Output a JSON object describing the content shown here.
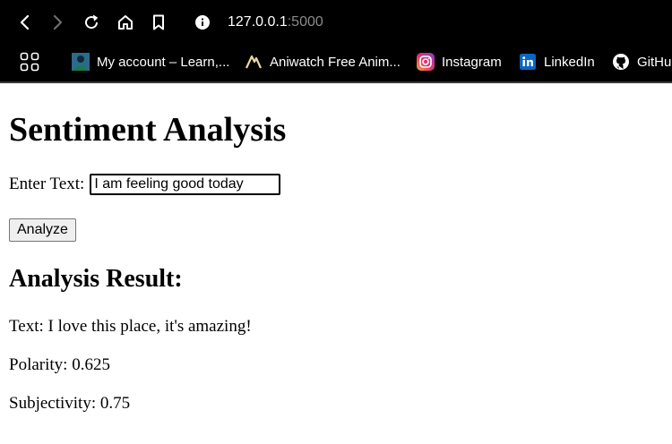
{
  "browser": {
    "url_host": "127.0.0.1",
    "url_port": ":5000",
    "bookmarks": [
      {
        "label": "My account – Learn,...",
        "icon": "avatar-icon"
      },
      {
        "label": "Aniwatch Free Anim...",
        "icon": "aniwatch-icon"
      },
      {
        "label": "Instagram",
        "icon": "instagram-icon"
      },
      {
        "label": "LinkedIn",
        "icon": "linkedin-icon"
      },
      {
        "label": "GitHub",
        "icon": "github-icon"
      }
    ]
  },
  "page": {
    "title": "Sentiment Analysis",
    "input_label": "Enter Text:",
    "input_value": "I am feeling good today",
    "analyze_label": "Analyze",
    "result_heading": "Analysis Result:",
    "result_text": "Text: I love this place, it's amazing!",
    "polarity": "Polarity: 0.625",
    "subjectivity": "Subjectivity: 0.75"
  }
}
